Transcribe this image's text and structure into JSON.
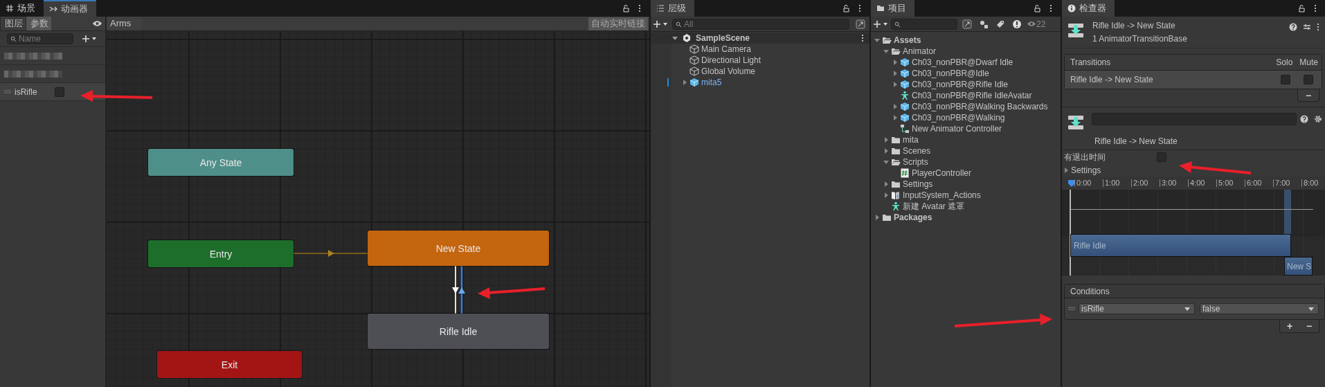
{
  "animator": {
    "tabs": [
      {
        "label": "场景",
        "selected": false
      },
      {
        "label": "动画器",
        "selected": true
      }
    ],
    "param_tabs": [
      {
        "label": "图层",
        "selected": false
      },
      {
        "label": "参数",
        "selected": true
      }
    ],
    "search": {
      "placeholder": "Name"
    },
    "parameters": [
      {
        "name": "isRifle",
        "checked": false
      }
    ],
    "breadcrumb": "Arms",
    "live_link_button": "自动实时链接",
    "states": [
      {
        "label": "Any State",
        "color": "#4f8f89"
      },
      {
        "label": "Entry",
        "color": "#1d6e2b"
      },
      {
        "label": "New State",
        "color": "#c4650f"
      },
      {
        "label": "Rifle Idle",
        "color": "#4e4f55"
      },
      {
        "label": "Exit",
        "color": "#a31515"
      }
    ]
  },
  "hierarchy": {
    "tab": "层级",
    "search": {
      "placeholder": "All"
    },
    "scene": {
      "name": "SampleScene",
      "expanded": true,
      "children": [
        {
          "name": "Main Camera",
          "kind": "object"
        },
        {
          "name": "Directional Light",
          "kind": "object"
        },
        {
          "name": "Global Volume",
          "kind": "object"
        },
        {
          "name": "mita5",
          "kind": "prefab",
          "expanded": false
        }
      ]
    }
  },
  "project": {
    "tab": "项目",
    "hidden_count": "22",
    "tree": [
      {
        "name": "Assets",
        "kind": "folder",
        "expanded": true,
        "children": [
          {
            "name": "Animator",
            "kind": "folder",
            "expanded": true,
            "children": [
              {
                "name": "Ch03_nonPBR@Dwarf Idle",
                "kind": "model",
                "expanded": false
              },
              {
                "name": "Ch03_nonPBR@Idle",
                "kind": "model",
                "expanded": false
              },
              {
                "name": "Ch03_nonPBR@Rifle Idle",
                "kind": "model",
                "expanded": false
              },
              {
                "name": "Ch03_nonPBR@Rifle IdleAvatar",
                "kind": "avatar"
              },
              {
                "name": "Ch03_nonPBR@Walking Backwards",
                "kind": "model",
                "expanded": false
              },
              {
                "name": "Ch03_nonPBR@Walking",
                "kind": "model",
                "expanded": false
              },
              {
                "name": "New Animator Controller",
                "kind": "controller"
              }
            ]
          },
          {
            "name": "mita",
            "kind": "folder",
            "expanded": false
          },
          {
            "name": "Scenes",
            "kind": "folder",
            "expanded": false
          },
          {
            "name": "Scripts",
            "kind": "folder",
            "expanded": true,
            "children": [
              {
                "name": "PlayerController",
                "kind": "script"
              }
            ]
          },
          {
            "name": "Settings",
            "kind": "folder",
            "expanded": false
          },
          {
            "name": "InputSystem_Actions",
            "kind": "input",
            "expanded": false
          },
          {
            "name": "新建 Avatar 遮罩",
            "kind": "avatar"
          }
        ]
      },
      {
        "name": "Packages",
        "kind": "folder",
        "expanded": false
      }
    ]
  },
  "inspector": {
    "tab": "检查器",
    "title": "Rifle Idle -> New State",
    "subtitle": "1 AnimatorTransitionBase",
    "transitions": {
      "header": "Transitions",
      "solo_header": "Solo",
      "mute_header": "Mute",
      "rows": [
        {
          "name": "Rifle Idle -> New State",
          "solo": false,
          "mute": false
        }
      ],
      "remove_button": "−"
    },
    "transition_label": "Rifle Idle -> New State",
    "has_exit_time": {
      "label": "有退出时间",
      "checked": false
    },
    "settings": {
      "label": "Settings",
      "expanded": false
    },
    "timeline": {
      "ticks": [
        "0:00",
        "1:00",
        "2:00",
        "3:00",
        "4:00",
        "5:00",
        "6:00",
        "7:00",
        "8:00"
      ],
      "source_clip": "Rifle Idle",
      "target_clip": "New S"
    },
    "conditions": {
      "header": "Conditions",
      "rows": [
        {
          "parameter": "isRifle",
          "value": "false"
        }
      ],
      "add_button": "+",
      "remove_button": "−"
    }
  }
}
